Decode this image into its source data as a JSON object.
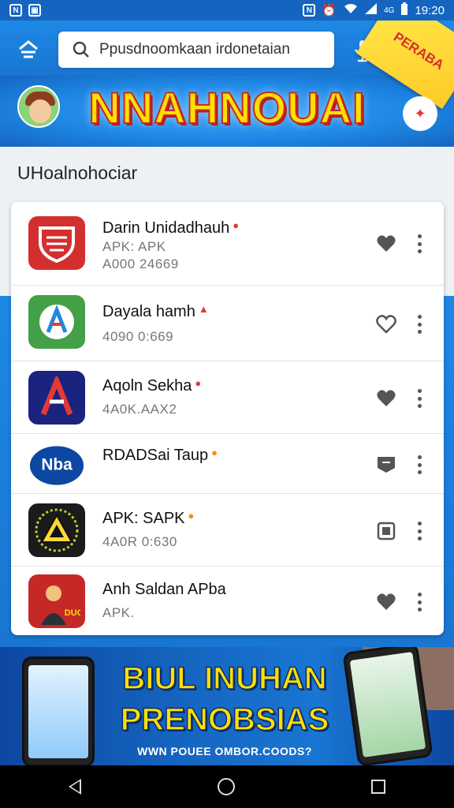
{
  "status_bar": {
    "time": "19:20",
    "left_icons": [
      "N",
      "image"
    ],
    "right_icons": [
      "n",
      "alarm",
      "wifi",
      "signal",
      "4G",
      "battery"
    ],
    "network_label": "4G"
  },
  "header": {
    "search_placeholder": "Ppusdnoomkaan irdonetaian",
    "ribbon_label": "PERABA",
    "brand_title": "NNAHNOUAI",
    "colors": {
      "header_bg": "#1976d2",
      "brand_yellow": "#ffe000",
      "brand_red": "#c62828"
    }
  },
  "section": {
    "title": "UHoalnohociar"
  },
  "apps": [
    {
      "name": "Darin Unidadhauh",
      "line1": "APK: APK",
      "line2": "A000 24669",
      "icon": "shield-icon",
      "icon_bg": "#d32f2f",
      "fav_icon": "heart-icon"
    },
    {
      "name": "Dayala hamh",
      "line1": "4090 0:669",
      "line2": "",
      "icon": "letter-a-icon",
      "icon_bg": "#43a047",
      "fav_icon": "heart-icon"
    },
    {
      "name": "Aqoln Sekha",
      "line1": "4A0K.AAX2",
      "line2": "",
      "icon": "letter-a-icon",
      "icon_bg": "#1a237e",
      "fav_icon": "heart-icon"
    },
    {
      "name": "RDADSai Taup",
      "line1": "",
      "line2": "",
      "icon": "nba-logo-icon",
      "icon_bg": "#0d47a1",
      "fav_icon": "bookmark-icon"
    },
    {
      "name": "APK: SAPK",
      "line1": "4A0R 0:630",
      "line2": "",
      "icon": "triangle-icon",
      "icon_bg": "#1b1b1b",
      "fav_icon": "square-icon"
    },
    {
      "name": "Anh Saldan APba",
      "line1": "APK.",
      "line2": "",
      "icon": "person-icon",
      "icon_bg": "#c62828",
      "fav_icon": "heart-icon"
    }
  ],
  "promo": {
    "title_line1": "BIUL INUHAN",
    "title_line2": "PRENOBSIAS",
    "url": "WWN POUEE OMBOR.COODS?"
  },
  "nav": {
    "back": "back-icon",
    "home": "home-icon",
    "recents": "recents-icon"
  }
}
